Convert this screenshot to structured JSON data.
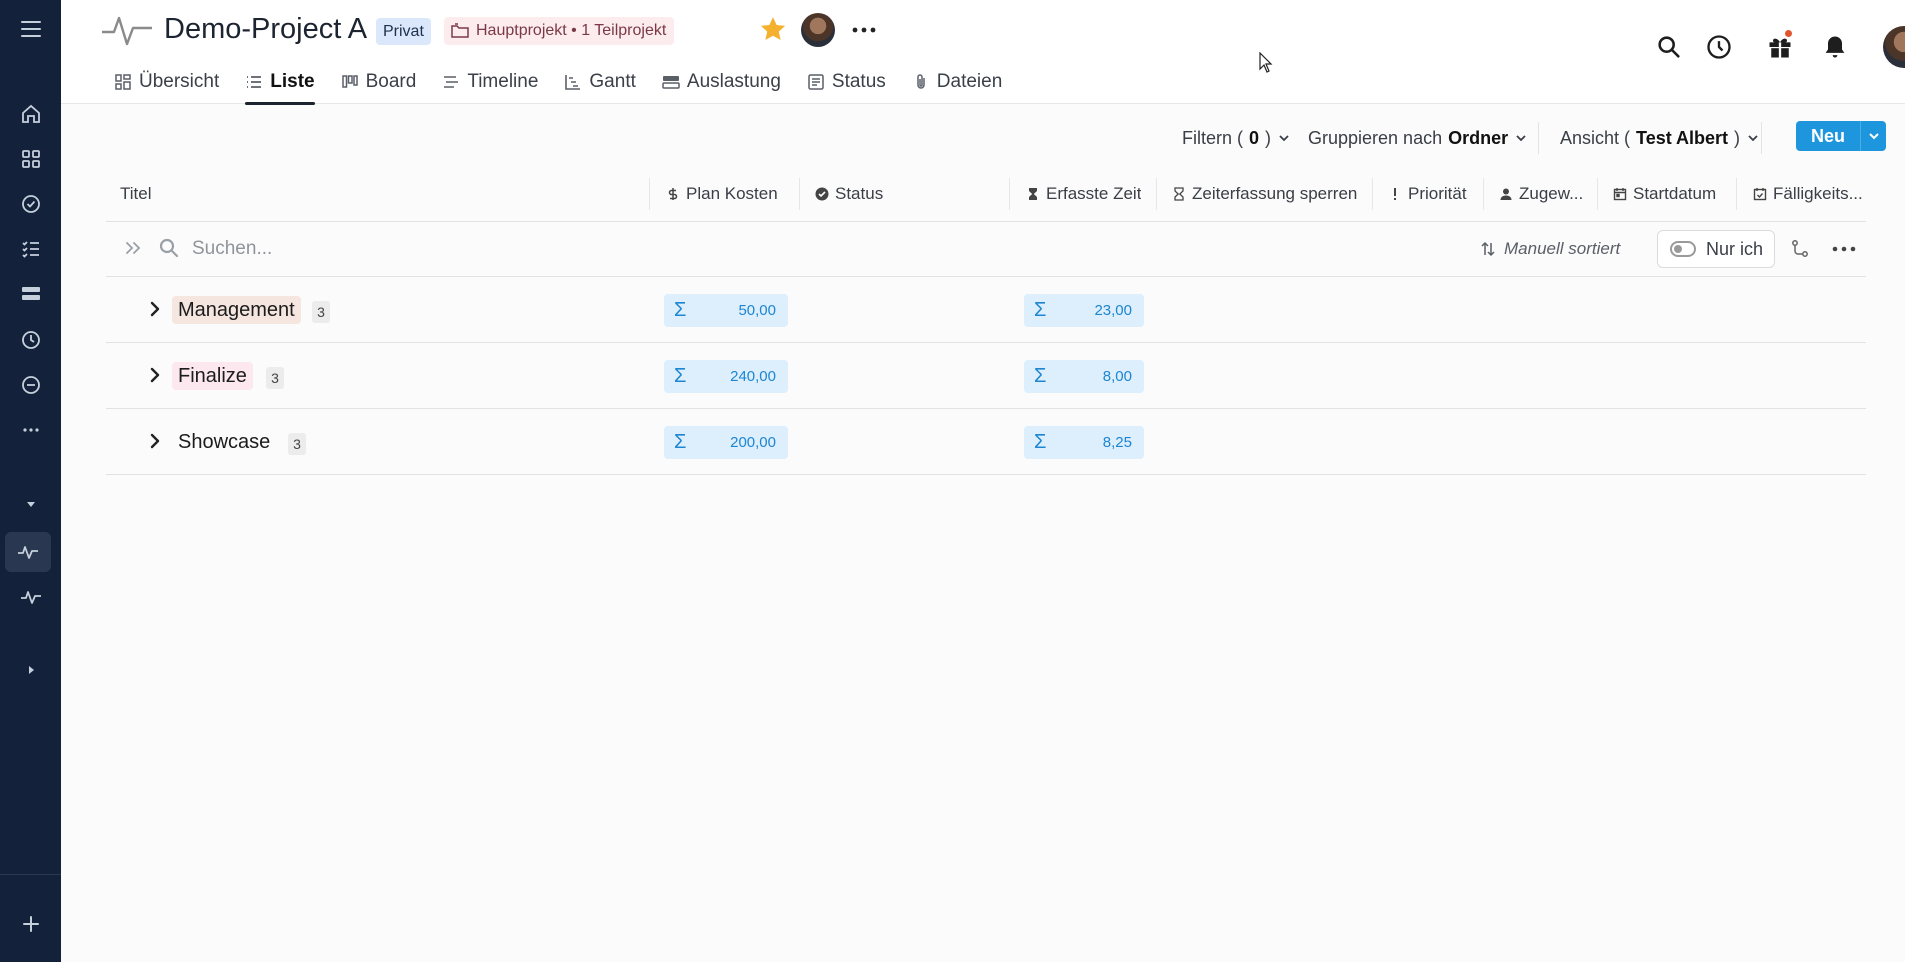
{
  "project": {
    "title": "Demo-Project A",
    "privacy_badge": "Privat",
    "hierarchy": "Hauptprojekt • 1 Teilprojekt"
  },
  "tabs": [
    {
      "label": "Übersicht",
      "icon": "overview-icon"
    },
    {
      "label": "Liste",
      "icon": "list-icon",
      "active": true
    },
    {
      "label": "Board",
      "icon": "board-icon"
    },
    {
      "label": "Timeline",
      "icon": "timeline-icon"
    },
    {
      "label": "Gantt",
      "icon": "gantt-icon"
    },
    {
      "label": "Auslastung",
      "icon": "workload-icon"
    },
    {
      "label": "Status",
      "icon": "status-doc-icon"
    },
    {
      "label": "Dateien",
      "icon": "paperclip-icon"
    }
  ],
  "toolbar": {
    "filter_prefix": "Filtern (",
    "filter_count": "0",
    "filter_suffix": ")",
    "group_prefix": "Gruppieren nach ",
    "group_value": "Ordner",
    "view_prefix": "Ansicht (",
    "view_value": "Test Albert",
    "view_suffix": ")",
    "new_label": "Neu"
  },
  "columns": [
    {
      "label": "Titel"
    },
    {
      "label": "Plan Kosten",
      "icon": "dollar-icon"
    },
    {
      "label": "Status",
      "icon": "check-circle-icon"
    },
    {
      "label": "Erfasste Zeit",
      "icon": "hourglass-filled-icon"
    },
    {
      "label": "Zeiterfassung sperren",
      "icon": "hourglass-icon"
    },
    {
      "label": "Priorität",
      "icon": "exclamation-icon"
    },
    {
      "label": "Zugew...",
      "icon": "person-icon"
    },
    {
      "label": "Startdatum",
      "icon": "calendar-icon"
    },
    {
      "label": "Fälligkeits...",
      "icon": "calendar-check-icon"
    }
  ],
  "search": {
    "placeholder": "Suchen...",
    "sort_label": "Manuell sortiert",
    "only_me_label": "Nur ich"
  },
  "groups": [
    {
      "name": "Management",
      "count": "3",
      "plan_kosten": "50,00",
      "erfasste_zeit": "23,00",
      "tag_color": "#f5e6e0"
    },
    {
      "name": "Finalize",
      "count": "3",
      "plan_kosten": "240,00",
      "erfasste_zeit": "8,00",
      "tag_color": "#fce8ee"
    },
    {
      "name": "Showcase",
      "count": "3",
      "plan_kosten": "200,00",
      "erfasste_zeit": "8,25",
      "tag_color": "transparent"
    }
  ],
  "sum_symbol": "Σ",
  "colors": {
    "sidebar_bg": "#14213a",
    "accent": "#1e96dd",
    "sum_bg": "#ddeefc",
    "star": "#f5b02d"
  }
}
